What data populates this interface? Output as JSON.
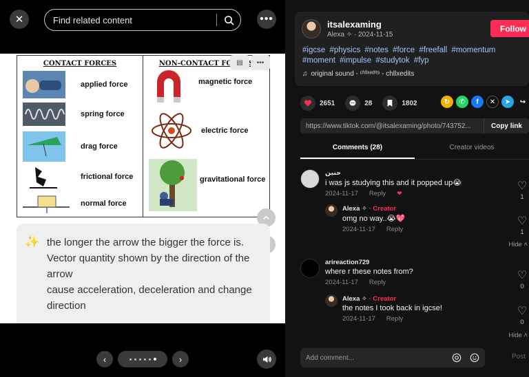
{
  "viewer": {
    "search_placeholder": "Find related content",
    "photo_card": {
      "contact_header": "CONTACT FORCES",
      "noncontact_header": "NON-CONTACT FORCES",
      "contact_forces": [
        "applied force",
        "spring force",
        "drag force",
        "frictional force",
        "normal force"
      ],
      "noncontact_forces": [
        "magnetic force",
        "electric force",
        "gravitational force"
      ],
      "note_lines": [
        "the longer the arrow the bigger the force is.",
        "Vector quantity shown by the direction of the arrow",
        "cause acceleration, deceleration and change direction"
      ]
    },
    "carousel": {
      "dot_count": 6,
      "active_index": 5
    }
  },
  "post": {
    "username": "itsalexaming",
    "display_name": "Alexa ✧",
    "date": "2024-11-15",
    "follow_label": "Follow",
    "hashtags": [
      "#igcse",
      "#physics",
      "#notes",
      "#force",
      "#freefall",
      "#momentum",
      "#moment",
      "#impulse",
      "#studytok",
      "#fyp"
    ],
    "sound": "original sound - ᶜʰˡˡˣᵉᵈⁱᵗˢ - chllxedits",
    "likes": "2651",
    "comments_count": "28",
    "saves": "1802",
    "link": "https://www.tiktok.com/@itsalexaming/photo/743752...",
    "copy_label": "Copy link",
    "tabs": [
      "Comments (28)",
      "Creator videos"
    ]
  },
  "comments": [
    {
      "name": "حنين",
      "text": "i was js studying this and it popped up😭",
      "date": "2024-11-17",
      "likes": "1",
      "reply_label": "Reply",
      "reply": {
        "name": "Alexa ✧",
        "tag": "· Creator",
        "text": "omg no way..😭💖",
        "date": "2024-11-17",
        "likes": "1",
        "reply_label": "Reply"
      },
      "hide_label": "Hide"
    },
    {
      "name": "arireaction729",
      "text": "where r these notes from?",
      "date": "2024-11-17",
      "likes": "0",
      "reply_label": "Reply",
      "reply": {
        "name": "Alexa ✧",
        "tag": "· Creator",
        "text": "the notes I took back in igcse!",
        "date": "2024-11-17",
        "likes": "0",
        "reply_label": "Reply"
      },
      "hide_label": "Hide"
    }
  ],
  "composer": {
    "placeholder": "Add comment...",
    "post_label": "Post"
  },
  "colors": {
    "accent": "#fe2c55",
    "hashtag": "#a9c3ff",
    "panel_bg": "#121212",
    "card_bg": "#202020"
  }
}
